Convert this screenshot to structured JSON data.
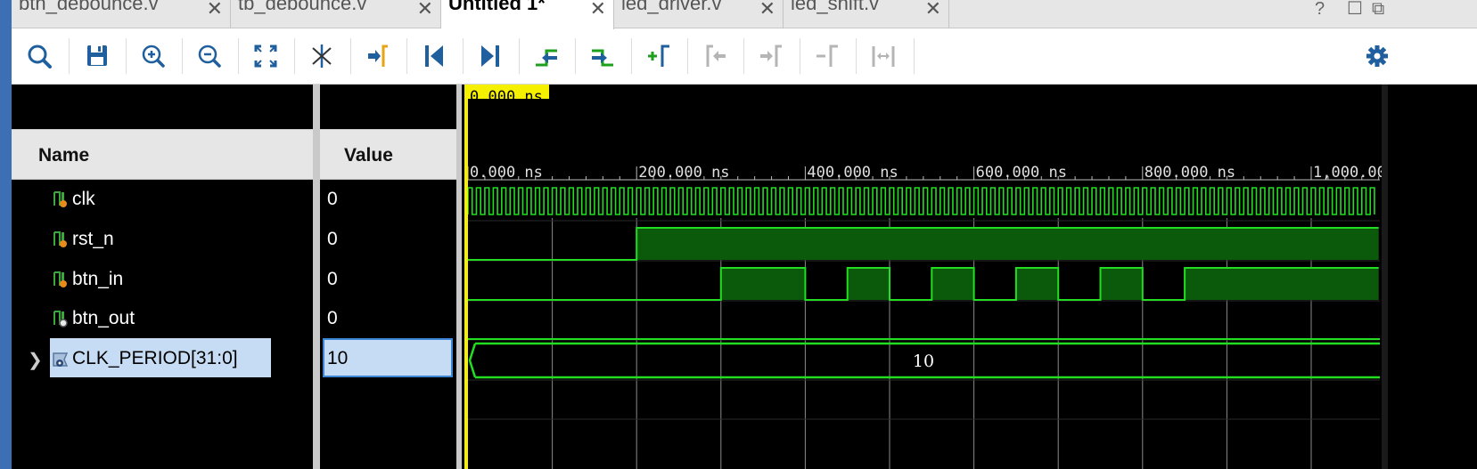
{
  "tabs": [
    {
      "label": "btn_debounce.v",
      "active": false
    },
    {
      "label": "tb_debounce.v",
      "active": false
    },
    {
      "label": "Untitled 1*",
      "active": true
    },
    {
      "label": "led_driver.v",
      "active": false
    },
    {
      "label": "led_shift.v",
      "active": false
    }
  ],
  "tab_close_glyph": "✕",
  "window_controls": {
    "help": "?",
    "restore": "☐",
    "float": "⧉"
  },
  "toolbar_icons": [
    "search-icon",
    "save-icon",
    "zoom-in-icon",
    "zoom-out-icon",
    "zoom-fit-icon",
    "cursor-snap-icon",
    "goto-cursor-icon",
    "goto-start-icon",
    "goto-end-icon",
    "prev-transition-icon",
    "next-transition-icon",
    "add-marker-icon",
    "prev-marker-icon",
    "next-marker-icon",
    "remove-marker-icon",
    "swap-cursors-icon",
    "settings-gear-icon"
  ],
  "columns": {
    "name": "Name",
    "value": "Value"
  },
  "signals": [
    {
      "name": "clk",
      "value": "0",
      "icon": "logic-input-icon"
    },
    {
      "name": "rst_n",
      "value": "0",
      "icon": "logic-input-icon"
    },
    {
      "name": "btn_in",
      "value": "0",
      "icon": "logic-input-icon"
    },
    {
      "name": "btn_out",
      "value": "0",
      "icon": "logic-output-icon"
    },
    {
      "name": "CLK_PERIOD[31:0]",
      "value": "10",
      "icon": "parameter-icon",
      "selected": true,
      "expandable": true
    }
  ],
  "cursor": {
    "time_label": "0.000 ns"
  },
  "timeline": {
    "ticks": [
      "0.000 ns",
      "200.000 ns",
      "400.000 ns",
      "600.000 ns",
      "800.000 ns",
      "1,000.00"
    ],
    "range_ns": [
      0,
      1080
    ]
  },
  "waveforms": {
    "clk": {
      "period_ns": 10
    },
    "rst_n": {
      "high_from_ns": 200
    },
    "btn_in": {
      "high_intervals_ns": [
        [
          300,
          400
        ],
        [
          450,
          500
        ],
        [
          550,
          600
        ],
        [
          650,
          700
        ],
        [
          750,
          800
        ],
        [
          850,
          1080
        ]
      ]
    },
    "btn_out": {
      "constant": 0
    },
    "CLK_PERIOD": {
      "bus_value": "10"
    }
  },
  "colors": {
    "wave": "#22dd22",
    "fill": "#0b5a0b",
    "cursor": "#f5f000",
    "grid": "#8a8a8a",
    "selection": "#c6dcf4"
  }
}
